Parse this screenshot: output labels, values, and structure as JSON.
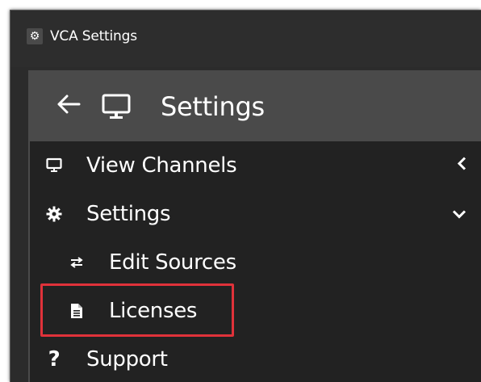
{
  "window": {
    "title": "VCA Settings",
    "app_icon": "gears-icon"
  },
  "header": {
    "back_icon": "arrow-left-icon",
    "monitor_icon": "monitor-icon",
    "title": "Settings"
  },
  "menu": {
    "items": [
      {
        "label": "View Channels",
        "icon": "monitor-icon",
        "chevron": "chevron-left-icon"
      },
      {
        "label": "Settings",
        "icon": "gear-icon",
        "chevron": "chevron-down-icon",
        "expanded": true
      },
      {
        "label": "Edit Sources",
        "icon": "swap-arrows-icon"
      },
      {
        "label": "Licenses",
        "icon": "document-icon",
        "highlighted": true
      },
      {
        "label": "Support",
        "icon": "question-icon"
      }
    ]
  },
  "colors": {
    "highlight_border": "#e0323a",
    "header_bg": "#4a4a4a",
    "panel_bg": "#222222"
  }
}
